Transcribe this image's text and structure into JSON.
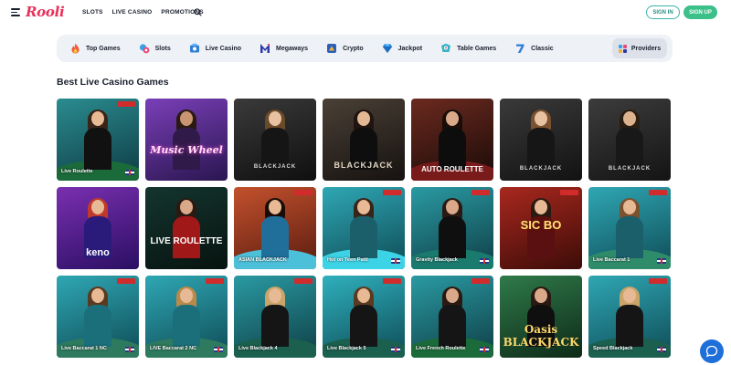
{
  "header": {
    "logo": "Rooli",
    "nav": [
      "SLOTS",
      "LIVE CASINO",
      "PROMOTIONS"
    ],
    "signin_label": "SIGN IN",
    "signup_label": "SIGN UP"
  },
  "categories": [
    {
      "label": "Top Games",
      "icon": "flame-icon"
    },
    {
      "label": "Slots",
      "icon": "slots-icon"
    },
    {
      "label": "Live Casino",
      "icon": "live-casino-icon"
    },
    {
      "label": "Megaways",
      "icon": "megaways-icon"
    },
    {
      "label": "Crypto",
      "icon": "crypto-icon"
    },
    {
      "label": "Jackpot",
      "icon": "diamond-icon"
    },
    {
      "label": "Table Games",
      "icon": "table-games-icon"
    },
    {
      "label": "Classic",
      "icon": "seven-icon"
    }
  ],
  "providers_label": "Providers",
  "section_title": "Best Live Casino Games",
  "games": [
    {
      "name": "Live Roulette",
      "big": ""
    },
    {
      "name": "",
      "big": "Music Wheel"
    },
    {
      "name": "",
      "big": "BLACKJACK"
    },
    {
      "name": "",
      "big": "BLACKJACK"
    },
    {
      "name": "",
      "big": "AUTO ROULETTE"
    },
    {
      "name": "",
      "big": "BLACKJACK"
    },
    {
      "name": "",
      "big": "BLACKJACK"
    },
    {
      "name": "",
      "big": "keno"
    },
    {
      "name": "",
      "big": "LIVE ROULETTE"
    },
    {
      "name": "ASIAN BLACKJACK",
      "big": ""
    },
    {
      "name": "Hot on Teen Patti",
      "big": ""
    },
    {
      "name": "Gravity Blackjack",
      "big": ""
    },
    {
      "name": "",
      "big": "SIC BO"
    },
    {
      "name": "Live Baccarat 1",
      "big": ""
    },
    {
      "name": "Live Baccarat 1 NC",
      "big": ""
    },
    {
      "name": "LIVE Baccarat 2 NC",
      "big": ""
    },
    {
      "name": "Live Blackjack 4",
      "big": ""
    },
    {
      "name": "Live Blackjack 5",
      "big": ""
    },
    {
      "name": "Live French Roulette",
      "big": ""
    },
    {
      "name": "",
      "big": "Oasis BLACKJACK"
    },
    {
      "name": "Speed Blackjack",
      "big": ""
    }
  ],
  "colors": {
    "brand": "#e8305a",
    "signup": "#3cc08a",
    "signin_border": "#3cb4a8",
    "chat": "#1e6fd9"
  }
}
